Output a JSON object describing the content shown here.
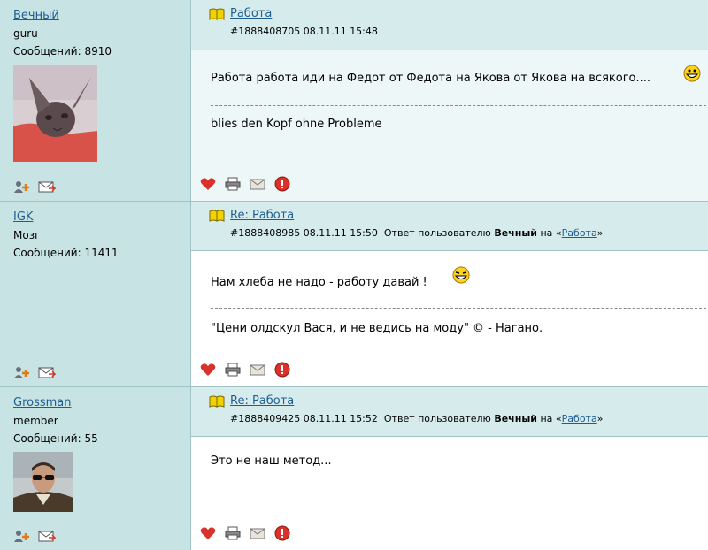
{
  "posts": [
    {
      "username": "Вечный",
      "rank": "guru",
      "messages_label": "Сообщений:",
      "messages_count": "8910",
      "title": "Работа",
      "post_id": "#1888408705",
      "date": "08.11.11",
      "time": "15:48",
      "reply_prefix": "",
      "reply_user": "",
      "reply_mid": "",
      "reply_link": "",
      "reply_suffix": "",
      "text": "Работа работа иди на Федот от Федота на Якова от Якова на всякого....",
      "signature": "blies den Kopf ohne Probleme"
    },
    {
      "username": "IGK",
      "rank": "Мозг",
      "messages_label": "Сообщений:",
      "messages_count": "11411",
      "title": "Re: Работа",
      "post_id": "#1888408985",
      "date": "08.11.11",
      "time": "15:50",
      "reply_prefix": "Ответ пользователю",
      "reply_user": "Вечный",
      "reply_mid": "на «",
      "reply_link": "Работа",
      "reply_suffix": "»",
      "text": "Нам хлеба не надо - работу давай !",
      "signature": "\"Цени олдскул Вася, и не ведись на моду\" © - Нагано."
    },
    {
      "username": "Grossman",
      "rank": "member",
      "messages_label": "Сообщений:",
      "messages_count": "55",
      "title": "Re: Работа",
      "post_id": "#1888409425",
      "date": "08.11.11",
      "time": "15:52",
      "reply_prefix": "Ответ пользователю",
      "reply_user": "Вечный",
      "reply_mid": "на «",
      "reply_link": "Работа",
      "reply_suffix": "»",
      "text": "Это не наш метод...",
      "signature": ""
    }
  ],
  "colors": {
    "sidebar_bg": "#c7e3e4",
    "header_bg": "#d6ebec",
    "link": "#1f5d8f",
    "border": "#9fc3c6"
  }
}
